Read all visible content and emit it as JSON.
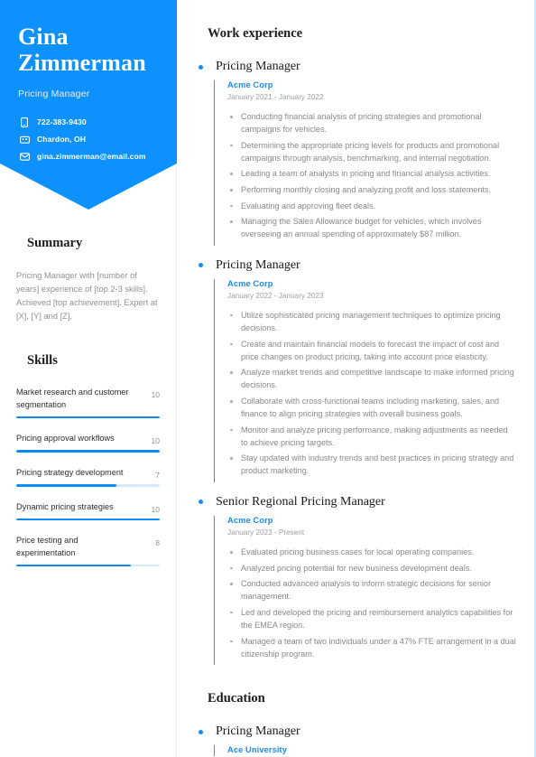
{
  "theme": {
    "accent": "#0d91fc",
    "tag_bg": "#e2e7ea",
    "bar_track": "#d6eafd",
    "text_muted": "#86898c"
  },
  "header": {
    "first_name": "Gina",
    "last_name": "Zimmerman",
    "job_title": "Pricing Manager",
    "contacts": [
      {
        "icon": "phone-icon",
        "value": "722-383-9430"
      },
      {
        "icon": "location-icon",
        "value": "Chardon, OH"
      },
      {
        "icon": "email-icon",
        "value": "gina.zimmerman@email.com"
      }
    ]
  },
  "sidebar": {
    "summary": {
      "heading": "Summary",
      "text": "Pricing Manager with [number of years] experience of [top 2-3 skills]. Achieved [top achievement]. Expert at [X], [Y] and [Z]."
    },
    "skills": {
      "heading": "Skills",
      "max": 10,
      "items": [
        {
          "name": "Market research and customer segmentation",
          "score": 10
        },
        {
          "name": "Pricing approval workflows",
          "score": 10
        },
        {
          "name": "Pricing strategy development",
          "score": 7
        },
        {
          "name": "Dynamic pricing strategies",
          "score": 10
        },
        {
          "name": "Price testing and experimentation",
          "score": 8
        }
      ]
    }
  },
  "main": {
    "work_experience": {
      "heading": "Work experience",
      "entries": [
        {
          "title": "Pricing Manager",
          "company": "Acme Corp",
          "dates": "January 2021 - January 2022",
          "duties": [
            "Conducting financial analysis of pricing strategies and promotional campaigns for vehicles.",
            "Determining the appropriate pricing levels for products and promotional campaigns through analysis, benchmarking, and internal negotiation.",
            "Leading a team of analysts in pricing and financial analysis activities.",
            "Performing monthly closing and analyzing profit and loss statements.",
            "Evaluating and approving fleet deals.",
            "Managing the Sales Allowance budget for vehicles, which involves overseeing an annual spending of approximately $87 million."
          ]
        },
        {
          "title": "Pricing Manager",
          "company": "Acme Corp",
          "dates": "January 2022 - January 2023",
          "duties": [
            "Utilize sophisticated pricing management techniques to optimize pricing decisions.",
            "Create and maintain financial models to forecast the impact of cost and price changes on product pricing, taking into account price elasticity.",
            "Analyze market trends and competitive landscape to make informed pricing decisions.",
            "Collaborate with cross-functional teams including marketing, sales, and finance to align pricing strategies with overall business goals.",
            "Monitor and analyze pricing performance, making adjustments as needed to achieve pricing targets.",
            "Stay updated with industry trends and best practices in pricing strategy and product marketing."
          ]
        },
        {
          "title": "Senior Regional Pricing Manager",
          "company": "Acme Corp",
          "dates": "January 2023 - Present",
          "duties": [
            "Evaluated pricing business cases for local operating companies.",
            "Analyzed pricing potential for new business development deals.",
            "Conducted advanced analysis to inform strategic decisions for senior management.",
            "Led and developed the pricing and reimbursement analytics capabilities for the EMEA region.",
            "Managed a team of two individuals under a 47% FTE arrangement in a dual citizenship program."
          ]
        }
      ]
    },
    "education": {
      "heading": "Education",
      "entries": [
        {
          "title": "Pricing Manager",
          "company": "Ace University"
        }
      ]
    }
  }
}
